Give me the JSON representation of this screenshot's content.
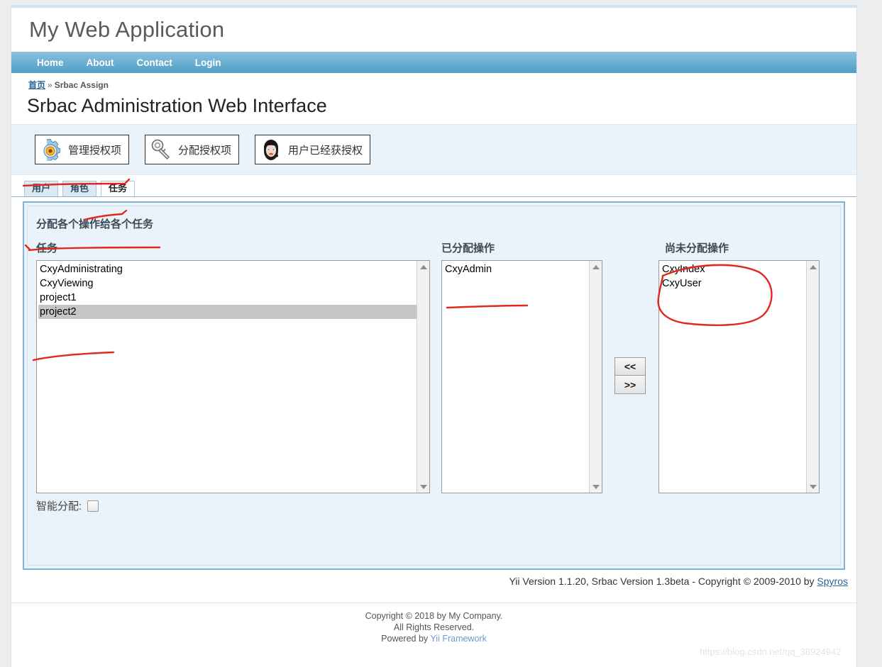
{
  "header": {
    "logo": "My Web Application"
  },
  "nav": {
    "items": [
      "Home",
      "About",
      "Contact",
      "Login"
    ]
  },
  "breadcrumb": {
    "home": "首页",
    "separator": "»",
    "current": "Srbac Assign"
  },
  "page": {
    "title": "Srbac Administration Web Interface"
  },
  "toolbar": {
    "buttons": [
      {
        "label": "管理授权项",
        "icon": "gear-icon"
      },
      {
        "label": "分配授权项",
        "icon": "key-icon"
      },
      {
        "label": "用户已经获授权",
        "icon": "user-face-icon"
      }
    ]
  },
  "tabs": [
    {
      "label": "用户",
      "active": false
    },
    {
      "label": "角色",
      "active": false
    },
    {
      "label": "任务",
      "active": true
    }
  ],
  "assign": {
    "title": "分配各个操作给各个任务",
    "tasks_label": "任务",
    "assigned_label": "已分配操作",
    "unassigned_label": "尚未分配操作",
    "tasks": [
      {
        "label": "CxyAdministrating",
        "selected": false
      },
      {
        "label": "CxyViewing",
        "selected": false
      },
      {
        "label": "project1",
        "selected": false
      },
      {
        "label": "project2",
        "selected": true
      }
    ],
    "assigned": [
      {
        "label": "CxyAdmin",
        "selected": false
      }
    ],
    "unassigned": [
      {
        "label": "CxyIndex",
        "selected": false
      },
      {
        "label": "CxyUser",
        "selected": false
      }
    ],
    "move_left_label": "<<",
    "move_right_label": ">>",
    "smart_assign_label": "智能分配:",
    "smart_assign_checked": false
  },
  "srbac_footer": {
    "text": "Yii Version 1.1.20,  Srbac Version 1.3beta - Copyright © 2009-2010 by ",
    "link": "Spyros"
  },
  "footer": {
    "line1": "Copyright © 2018 by My Company.",
    "line2": "All Rights Reserved.",
    "line3_prefix": "Powered by ",
    "line3_link": "Yii Framework"
  },
  "watermark": {
    "text": "https://blog.csdn.net/qq_38924942"
  },
  "colors": {
    "nav_top": "#8cc2de",
    "nav_bottom": "#4f9ec7",
    "panel_border": "#7fb4d6",
    "panel_bg": "#eaf2fa",
    "annotation_red": "#e0281e",
    "selection_gray": "#c6c6c6"
  }
}
